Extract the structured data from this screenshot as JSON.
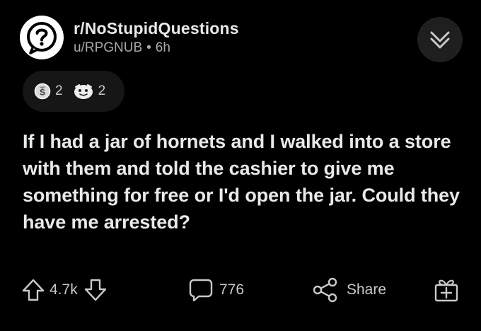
{
  "post": {
    "subreddit": "r/NoStupidQuestions",
    "author": "u/RPGNUB",
    "separator": "•",
    "age": "6h",
    "title": "If I had a jar of hornets and I walked into a store with them and told the cashier to give me something for free or I'd open the jar. Could they have me arrested?"
  },
  "avatar": {
    "icon": "question-mark-icon",
    "bg": "#ffffff"
  },
  "awards": [
    {
      "icon": "silver-coin-award-icon",
      "count": "2"
    },
    {
      "icon": "helpful-face-award-icon",
      "count": "2"
    }
  ],
  "actions": {
    "upvote_icon": "arrow-up-icon",
    "score": "4.7k",
    "downvote_icon": "arrow-down-icon",
    "comment_icon": "speech-bubble-icon",
    "comments": "776",
    "share_icon": "share-icon",
    "share_label": "Share",
    "award_icon": "gift-icon"
  },
  "colors": {
    "background": "#000000",
    "text": "#e8e9ea",
    "muted": "#a8aaab",
    "pill": "#161616"
  }
}
